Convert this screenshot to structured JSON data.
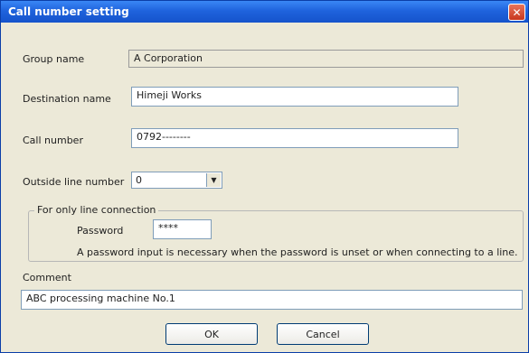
{
  "window": {
    "title": "Call number setting"
  },
  "form": {
    "group_name_label": "Group name",
    "group_name_value": "A Corporation",
    "destination_label": "Destination name",
    "destination_value": "Himeji Works",
    "call_number_label": "Call number",
    "call_number_value": "0792--------",
    "outside_label": "Outside line number",
    "outside_value": "0",
    "line_group_title": "For only line connection",
    "password_label": "Password",
    "password_value": "****",
    "password_note": "A password input is necessary when the password is unset or when connecting to a line.",
    "comment_label": "Comment",
    "comment_value": "ABC processing machine No.1"
  },
  "buttons": {
    "ok": "OK",
    "cancel": "Cancel"
  },
  "icons": {
    "close": "close-icon",
    "dropdown": "chevron-down-icon"
  }
}
